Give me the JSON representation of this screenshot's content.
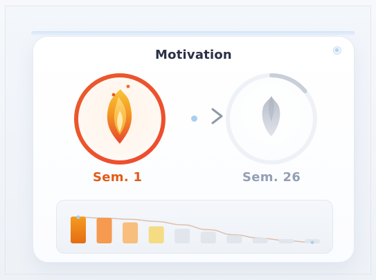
{
  "title": "Motivation",
  "labels": {
    "left": "Sem. 1",
    "right": "Sem. 26"
  },
  "icons": {
    "left_flame": "flame-icon",
    "right_seed": "seed-icon",
    "arrow": "chevron-right-icon",
    "corner": "status-dot-icon"
  },
  "progress": {
    "week26_ring_fill": 0.14
  },
  "chart_data": {
    "type": "bar",
    "values": [
      0.88,
      0.84,
      0.69,
      0.56,
      0.48,
      0.38,
      0.27,
      0.18,
      0.1,
      0.04
    ],
    "colors": [
      "#ef7e1c",
      "#f59a4f",
      "#f8be7d",
      "#f5dc83",
      "#e1e5ec",
      "#e1e5ec",
      "#e1e5ec",
      "#e1e5ec",
      "#e1e5ec",
      "#e1e5ec"
    ],
    "trend": [
      0.86,
      0.83,
      0.79,
      0.72,
      0.61,
      0.45,
      0.28,
      0.17,
      0.09,
      0.03
    ],
    "ylim": [
      0,
      1
    ],
    "grid": false
  },
  "colors": {
    "accent_orange": "#e35a16",
    "accent_red": "#e6452f",
    "accent_yellow": "#f3c85c",
    "muted_gray": "#93a0b3",
    "chart_bar_gray": "#e1e5ec",
    "trend_line": "#dcbaa9",
    "dot_blue": "#a9cfee"
  }
}
